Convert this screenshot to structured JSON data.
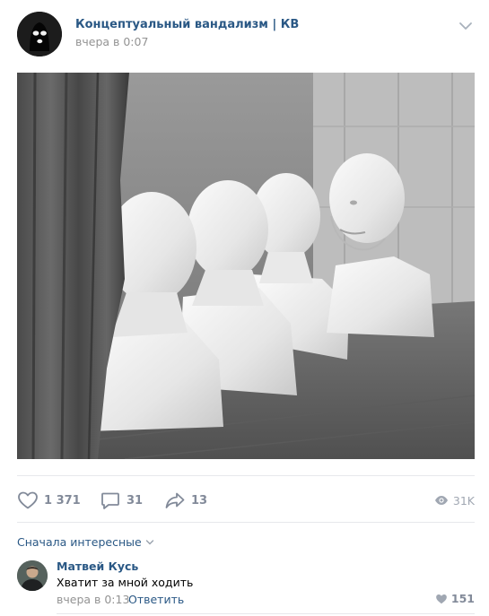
{
  "post": {
    "author": "Концептуальный вандализм | КВ",
    "time": "вчера в 0:07"
  },
  "actions": {
    "likes": "1 371",
    "comments": "31",
    "shares": "13",
    "views": "31K"
  },
  "comments_section": {
    "sort_label": "Сначала интересные"
  },
  "comment": {
    "author": "Матвей Кусь",
    "text": "Хватит за мной ходить",
    "time": "вчера в 0:13",
    "reply_label": "Ответить",
    "likes": "151"
  },
  "colors": {
    "link": "#2a5885",
    "muted": "#939393",
    "icon": "#828a99",
    "divider": "#e7e8ec"
  },
  "icons": [
    "balaclava-logo-icon",
    "chevron-down-icon",
    "heart-icon",
    "comment-icon",
    "share-icon",
    "eye-icon"
  ]
}
